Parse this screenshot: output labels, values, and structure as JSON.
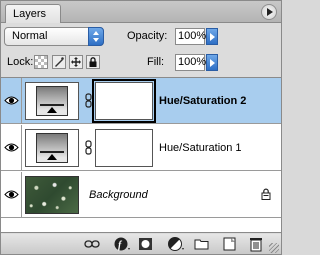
{
  "panel": {
    "tab_label": "Layers"
  },
  "blend": {
    "mode": "Normal"
  },
  "opacity": {
    "label": "Opacity:",
    "value": "100%"
  },
  "lock": {
    "label": "Lock:"
  },
  "fill": {
    "label": "Fill:",
    "value": "100%"
  },
  "layers": [
    {
      "name": "Hue/Saturation 2",
      "selected": true,
      "visible": true
    },
    {
      "name": "Hue/Saturation 1",
      "selected": false,
      "visible": true
    },
    {
      "name": "Background",
      "selected": false,
      "visible": true,
      "locked": true
    }
  ],
  "colors": {
    "selection": "#a8cdee",
    "accent_blue": "#2e6fc5"
  },
  "toolbar_icons": [
    "link-layers-icon",
    "layer-style-icon",
    "add-mask-icon",
    "new-adjustment-layer-icon",
    "new-group-icon",
    "new-layer-icon",
    "delete-layer-icon"
  ]
}
